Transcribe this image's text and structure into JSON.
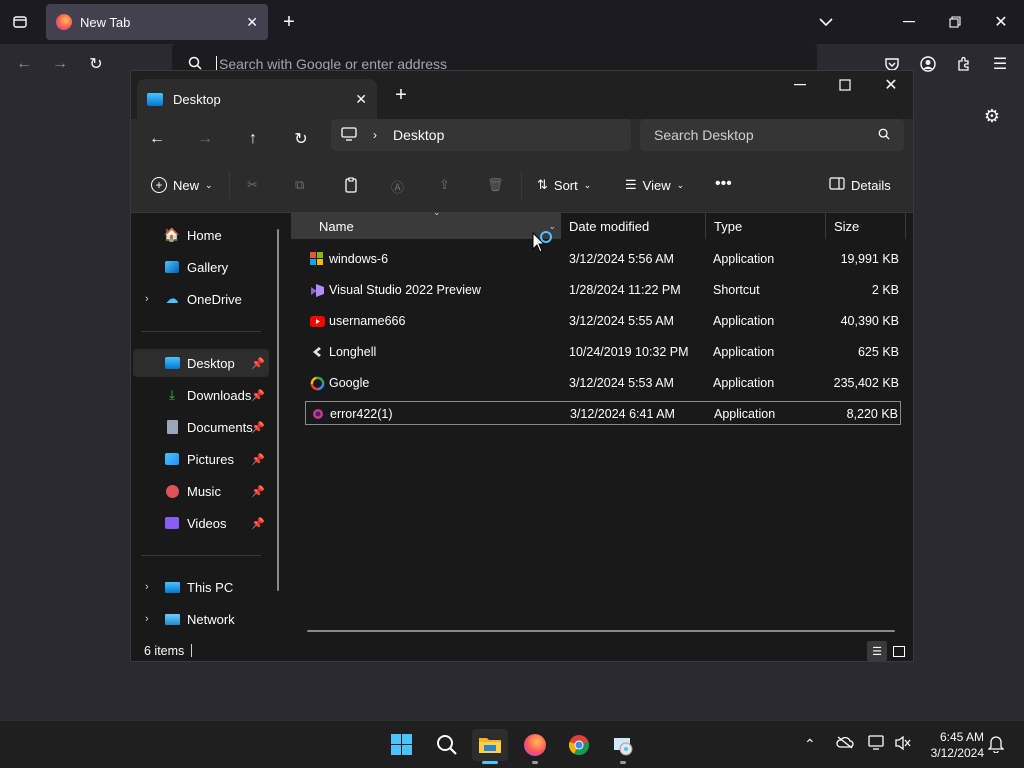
{
  "firefox": {
    "tab_title": "New Tab",
    "url_placeholder": "Search with Google or enter address"
  },
  "explorer": {
    "tab_title": "Desktop",
    "breadcrumb": "Desktop",
    "search_placeholder": "Search Desktop",
    "commands": {
      "new_label": "New",
      "sort_label": "Sort",
      "view_label": "View",
      "details_label": "Details"
    },
    "nav": {
      "home": "Home",
      "gallery": "Gallery",
      "onedrive": "OneDrive",
      "desktop": "Desktop",
      "downloads": "Downloads",
      "documents": "Documents",
      "pictures": "Pictures",
      "music": "Music",
      "videos": "Videos",
      "this_pc": "This PC",
      "network": "Network"
    },
    "columns": {
      "name": "Name",
      "date": "Date modified",
      "type": "Type",
      "size": "Size"
    },
    "files": [
      {
        "name": "windows-6",
        "date": "3/12/2024 5:56 AM",
        "type": "Application",
        "size": "19,991 KB",
        "icon": "windows-logo-icon"
      },
      {
        "name": "Visual Studio 2022 Preview",
        "date": "1/28/2024 11:22 PM",
        "type": "Shortcut",
        "size": "2 KB",
        "icon": "visual-studio-icon"
      },
      {
        "name": "username666",
        "date": "3/12/2024 5:55 AM",
        "type": "Application",
        "size": "40,390 KB",
        "icon": "youtube-icon"
      },
      {
        "name": "Longhell",
        "date": "10/24/2019 10:32 PM",
        "type": "Application",
        "size": "625 KB",
        "icon": "longhell-icon"
      },
      {
        "name": "Google",
        "date": "3/12/2024 5:53 AM",
        "type": "Application",
        "size": "235,402 KB",
        "icon": "google-icon"
      },
      {
        "name": "error422(1)",
        "date": "3/12/2024 6:41 AM",
        "type": "Application",
        "size": "8,220 KB",
        "icon": "error-app-icon"
      }
    ],
    "status_text": "6 items"
  },
  "taskbar": {
    "time": "6:45 AM",
    "date": "3/12/2024"
  },
  "colors": {
    "accent": "#0078d4",
    "selection": "#3a3a3a"
  }
}
